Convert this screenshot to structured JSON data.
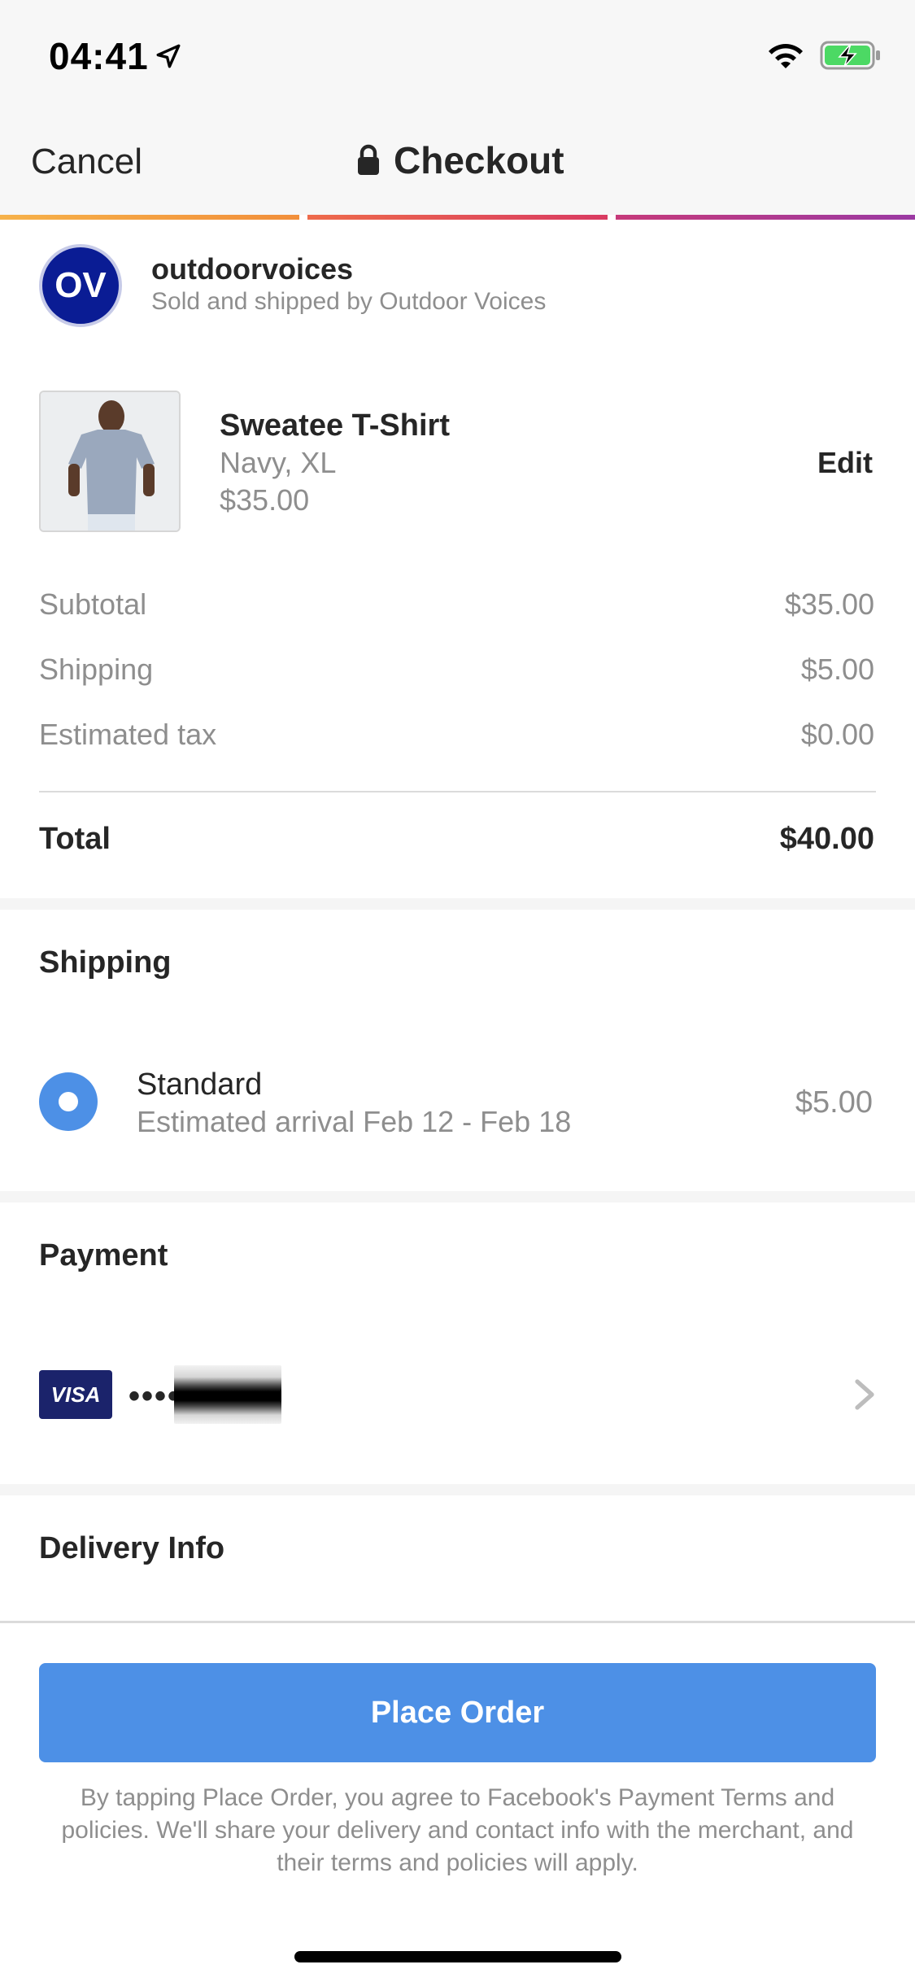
{
  "status_bar": {
    "time": "04:41"
  },
  "header": {
    "cancel_label": "Cancel",
    "title": "Checkout"
  },
  "merchant": {
    "logo_text": "OV",
    "name": "outdoorvoices",
    "subtitle": "Sold and shipped by Outdoor Voices"
  },
  "product": {
    "name": "Sweatee T-Shirt",
    "variant": "Navy, XL",
    "price": "$35.00",
    "edit_label": "Edit"
  },
  "summary": {
    "rows": [
      {
        "label": "Subtotal",
        "value": "$35.00"
      },
      {
        "label": "Shipping",
        "value": "$5.00"
      },
      {
        "label": "Estimated tax",
        "value": "$0.00"
      }
    ],
    "total_label": "Total",
    "total_value": "$40.00"
  },
  "shipping": {
    "title": "Shipping",
    "option_name": "Standard",
    "option_eta": "Estimated arrival Feb 12 - Feb 18",
    "option_price": "$5.00"
  },
  "payment": {
    "title": "Payment",
    "card_brand": "VISA",
    "card_mask": "••••"
  },
  "delivery": {
    "title": "Delivery Info"
  },
  "footer": {
    "button_label": "Place Order",
    "terms": "By tapping Place Order, you agree to Facebook's Payment Terms and policies. We'll share your delivery and contact info with the merchant, and their terms and policies will apply."
  },
  "colors": {
    "accent_blue": "#4d90e6",
    "merchant_logo": "#0a1c94",
    "visa_badge": "#1b236b"
  },
  "icons": [
    "location-arrow-icon",
    "wifi-icon",
    "battery-charging-icon",
    "lock-icon",
    "chevron-right-icon",
    "radio-selected-icon"
  ]
}
